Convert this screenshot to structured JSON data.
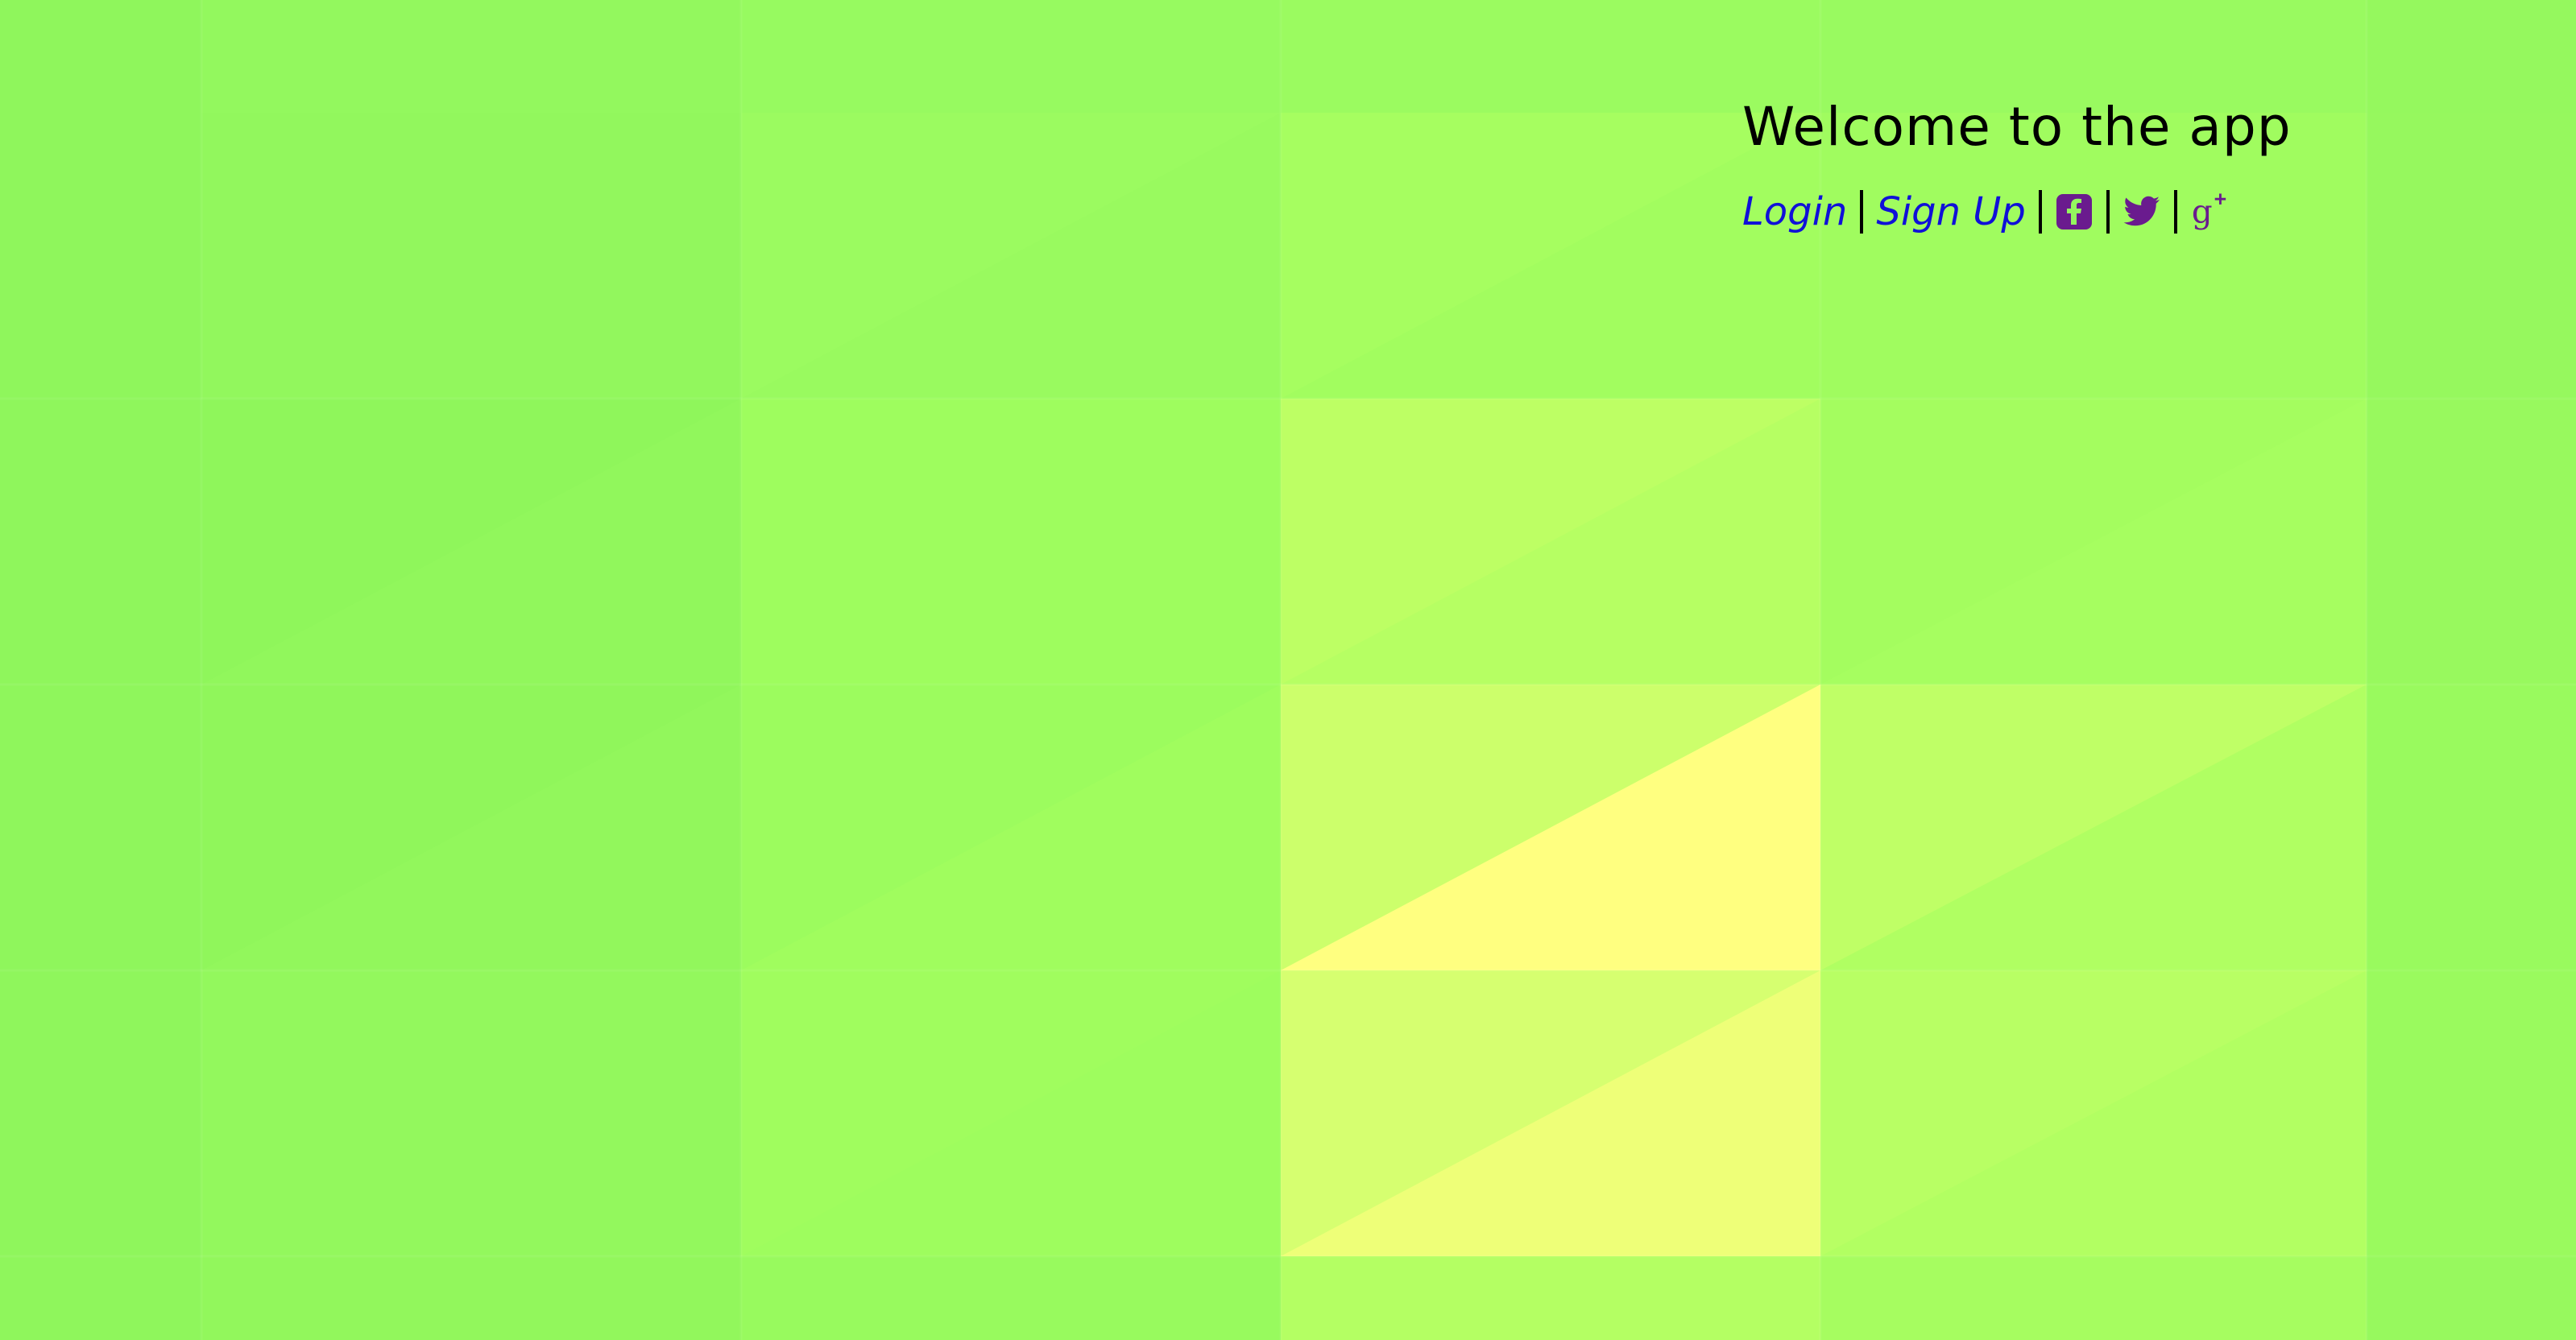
{
  "header": {
    "title": "Welcome to the app"
  },
  "nav": {
    "login_label": "Login",
    "signup_label": "Sign Up",
    "social": [
      "facebook-icon",
      "twitter-icon",
      "google-plus-icon"
    ]
  },
  "colors": {
    "background_green": "#94f85f",
    "highlight_yellow": "#ffff80",
    "link_blue": "#1010d8",
    "icon_purple": "#6a1b8e",
    "title_black": "#000000"
  }
}
